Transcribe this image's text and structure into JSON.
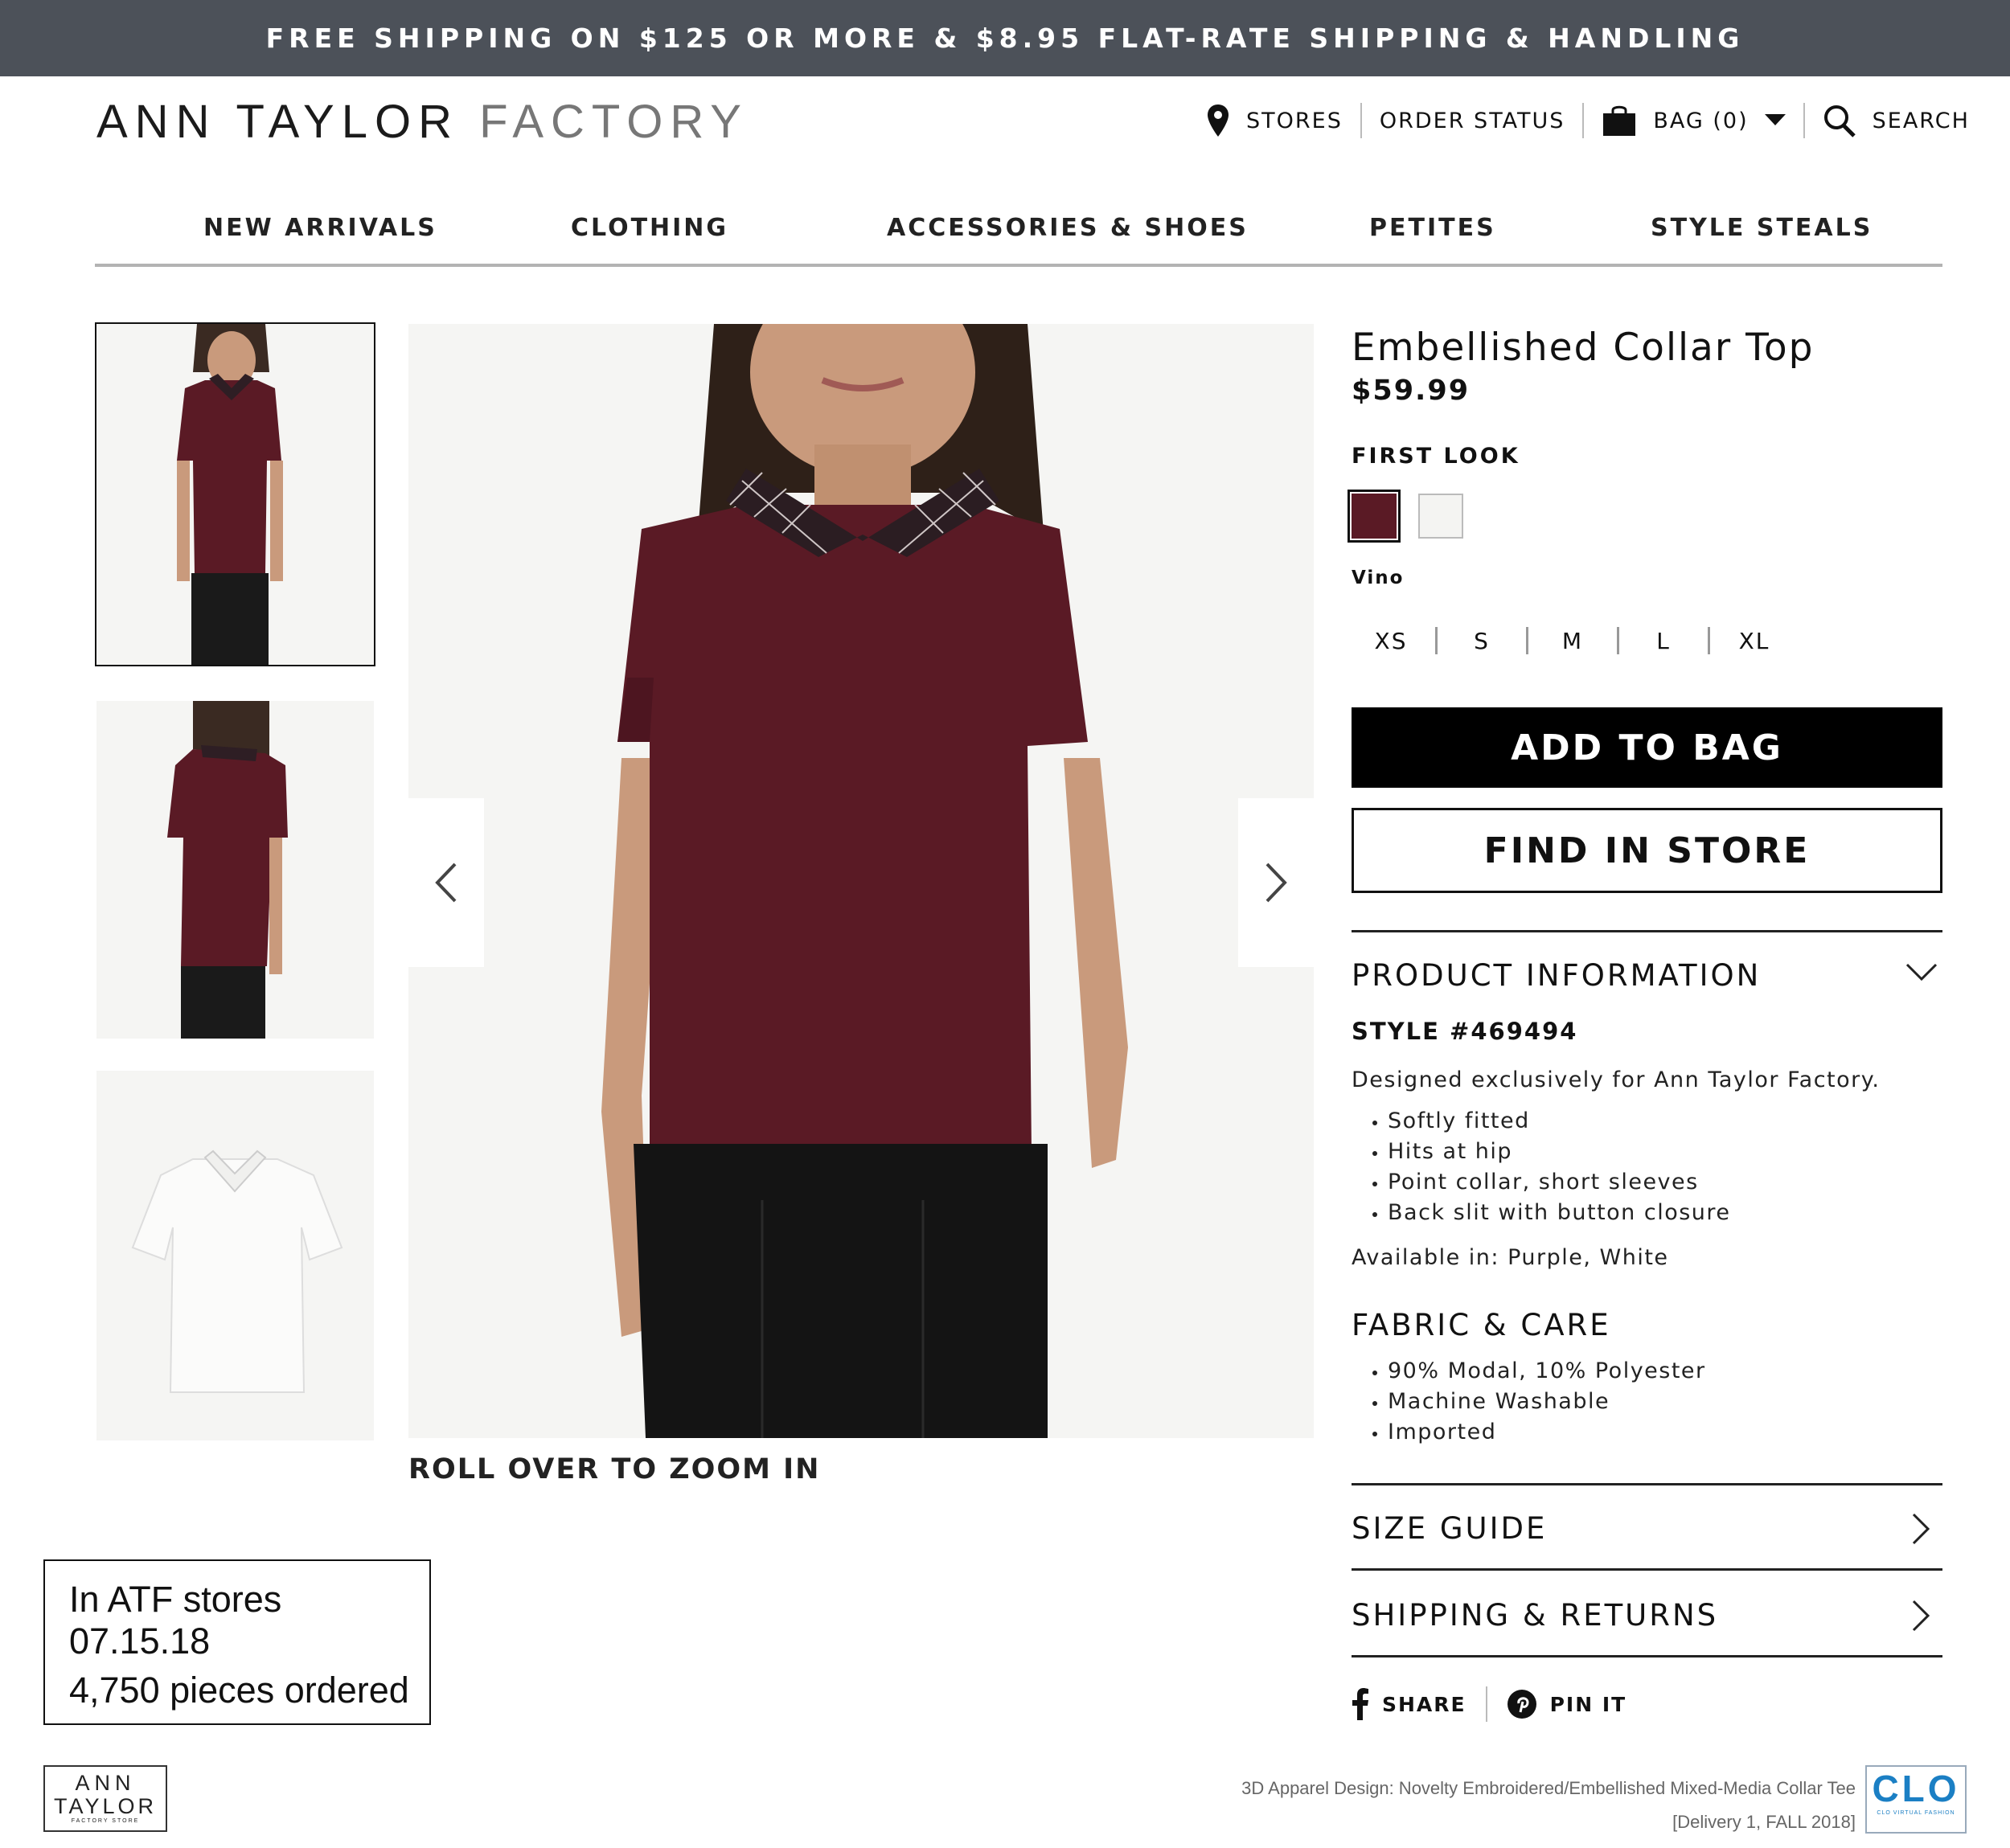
{
  "promo": {
    "text": "FREE SHIPPING ON $125 OR MORE & $8.95 FLAT-RATE SHIPPING & HANDLING"
  },
  "header": {
    "logo_part1": "ANN TAYLOR",
    "logo_part2": "FACTORY",
    "stores": "STORES",
    "order_status": "ORDER STATUS",
    "bag": "BAG (0)",
    "search": "SEARCH"
  },
  "nav": [
    "NEW ARRIVALS",
    "CLOTHING",
    "ACCESSORIES & SHOES",
    "PETITES",
    "STYLE STEALS"
  ],
  "gallery": {
    "zoom_hint": "ROLL OVER TO ZOOM IN"
  },
  "product": {
    "title": "Embellished Collar Top",
    "price": "$59.99",
    "color_label": "FIRST LOOK",
    "swatches": [
      {
        "name": "Vino",
        "color": "#5a1a25"
      },
      {
        "name": "White",
        "color": "#f4f4f2"
      }
    ],
    "selected_color": "Vino",
    "sizes": [
      "XS",
      "S",
      "M",
      "L",
      "XL"
    ],
    "add_to_bag": "ADD TO BAG",
    "find_in_store": "FIND IN STORE"
  },
  "info": {
    "heading": "PRODUCT INFORMATION",
    "style": "STYLE #469494",
    "description": "Designed exclusively for Ann Taylor Factory.",
    "bullets": [
      "Softly fitted",
      "Hits at hip",
      "Point collar, short sleeves",
      "Back slit with button closure"
    ],
    "available": "Available in: Purple, White",
    "fabric_heading": "FABRIC & CARE",
    "fabric_bullets": [
      "90% Modal, 10% Polyester",
      "Machine Washable",
      "Imported"
    ],
    "size_guide": "SIZE GUIDE",
    "shipping": "SHIPPING & RETURNS"
  },
  "share": {
    "share": "SHARE",
    "pin": "PIN IT"
  },
  "annotation": {
    "line1": "In ATF stores 07.15.18",
    "line2": "4,750 pieces ordered"
  },
  "footer": {
    "logo_l1": "ANN",
    "logo_l2": "TAYLOR",
    "logo_l3": "FACTORY STORE",
    "credit_line1": "3D Apparel Design: Novelty Embroidered/Embellished Mixed-Media Collar Tee",
    "credit_line2": "[Delivery 1, FALL 2018]",
    "clo_logo": "CLO",
    "clo_sub": "CLO VIRTUAL FASHION"
  }
}
